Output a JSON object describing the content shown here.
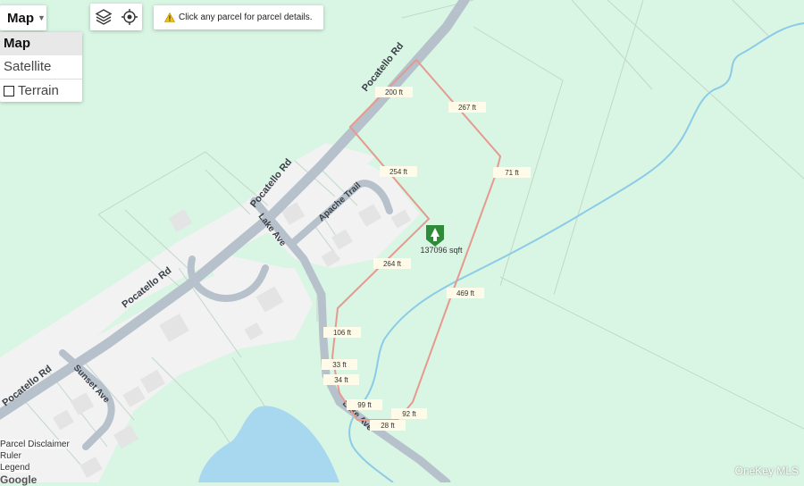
{
  "controls": {
    "map_button": "Map",
    "map_types": [
      "Map",
      "Satellite",
      "Terrain"
    ],
    "selected_map_type": "Map",
    "tool_icons": [
      "layers-icon",
      "locate-icon"
    ]
  },
  "notice": {
    "icon": "warning-icon",
    "text": "Click any parcel for parcel details."
  },
  "roads": {
    "pocatello_1": "Pocatello Rd",
    "pocatello_2": "Pocatello Rd",
    "pocatello_3": "Pocatello Rd",
    "pocatello_4": "Pocatello Rd",
    "apache": "Apache Trail",
    "lake_1": "Lake Ave",
    "lake_2": "Lake Ave",
    "sunset": "Sunset Ave"
  },
  "parcel": {
    "area": "137096 sqft",
    "icon": "parcel-tree-icon",
    "dimensions": [
      "200 ft",
      "267 ft",
      "254 ft",
      "71 ft",
      "264 ft",
      "469 ft",
      "106 ft",
      "33 ft",
      "34 ft",
      "99 ft",
      "92 ft",
      "28 ft"
    ]
  },
  "footer": {
    "links": [
      "Parcel Disclaimer",
      "Ruler",
      "Legend"
    ],
    "google": "Google",
    "watermark": "OneKey MLS"
  },
  "colors": {
    "land": "#d9f5e3",
    "road": "#b6c1cb",
    "water": "#a7d8ef",
    "parcel_line": "#e69a8f",
    "stream": "#8ccbe8",
    "developed": "#f2f2f2"
  }
}
